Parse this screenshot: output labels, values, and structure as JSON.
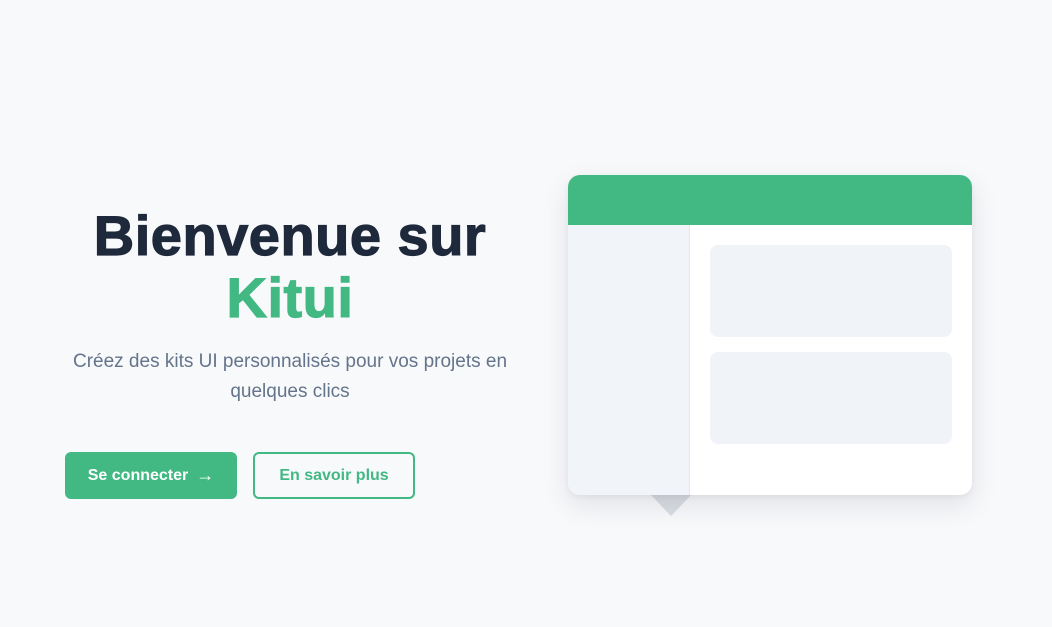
{
  "hero": {
    "title_line1": "Bienvenue sur",
    "title_brand": "Kitui",
    "subtitle": "Créez des kits UI personnalisés pour vos projets en quelques clics"
  },
  "actions": {
    "primary_label": "Se connecter",
    "primary_icon": "arrow-right-icon",
    "primary_arrow": "→",
    "secondary_label": "En savoir plus"
  },
  "colors": {
    "accent": "#42b883",
    "title": "#1e293b",
    "muted": "#64748b",
    "background": "#f8f9fb"
  }
}
